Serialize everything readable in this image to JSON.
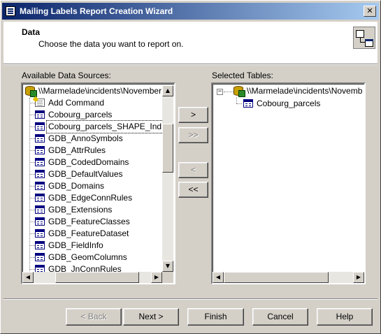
{
  "window": {
    "title": "Mailing Labels Report Creation Wizard",
    "close_label": "✕"
  },
  "header": {
    "title": "Data",
    "subtitle": "Choose the data you want to report on."
  },
  "available": {
    "label": "Available Data Sources:",
    "root": "\\\\Marmelade\\incidents\\November",
    "items": [
      {
        "label": "Add Command",
        "icon": "add-command-icon"
      },
      {
        "label": "Cobourg_parcels",
        "icon": "table-icon"
      },
      {
        "label": "Cobourg_parcels_SHAPE_Ind",
        "icon": "table-icon",
        "selected": true
      },
      {
        "label": "GDB_AnnoSymbols",
        "icon": "table-icon"
      },
      {
        "label": "GDB_AttrRules",
        "icon": "table-icon"
      },
      {
        "label": "GDB_CodedDomains",
        "icon": "table-icon"
      },
      {
        "label": "GDB_DefaultValues",
        "icon": "table-icon"
      },
      {
        "label": "GDB_Domains",
        "icon": "table-icon"
      },
      {
        "label": "GDB_EdgeConnRules",
        "icon": "table-icon"
      },
      {
        "label": "GDB_Extensions",
        "icon": "table-icon"
      },
      {
        "label": "GDB_FeatureClasses",
        "icon": "table-icon"
      },
      {
        "label": "GDB_FeatureDataset",
        "icon": "table-icon"
      },
      {
        "label": "GDB_FieldInfo",
        "icon": "table-icon"
      },
      {
        "label": "GDB_GeomColumns",
        "icon": "table-icon"
      },
      {
        "label": "GDB_JnConnRules",
        "icon": "table-icon"
      }
    ]
  },
  "selected": {
    "label": "Selected Tables:",
    "root": "\\\\Marmelade\\incidents\\Novemb",
    "expander": "−",
    "items": [
      {
        "label": "Cobourg_parcels",
        "icon": "table-icon"
      }
    ]
  },
  "transfer": {
    "add": ">",
    "add_all": ">>",
    "remove": "<",
    "remove_all": "<<"
  },
  "scroll_arrows": {
    "up": "▲",
    "down": "▼",
    "left": "◀",
    "right": "▶"
  },
  "footer": {
    "back": "< Back",
    "next": "Next >",
    "finish": "Finish",
    "cancel": "Cancel",
    "help": "Help"
  }
}
